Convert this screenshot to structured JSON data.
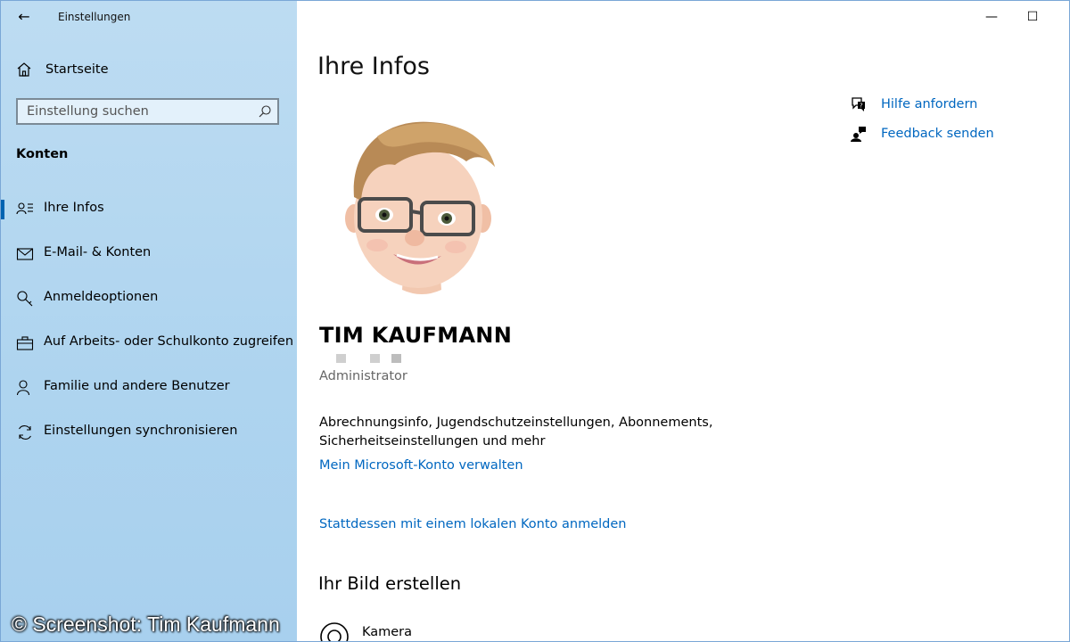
{
  "window": {
    "title": "Einstellungen"
  },
  "sidebar": {
    "home_label": "Startseite",
    "search_placeholder": "Einstellung suchen",
    "section_title": "Konten",
    "items": [
      {
        "label": "Ihre Infos",
        "icon": "person-list-icon",
        "selected": true
      },
      {
        "label": "E-Mail- & Konten",
        "icon": "mail-icon",
        "selected": false
      },
      {
        "label": "Anmeldeoptionen",
        "icon": "key-icon",
        "selected": false
      },
      {
        "label": "Auf Arbeits- oder Schulkonto zugreifen",
        "icon": "briefcase-icon",
        "selected": false
      },
      {
        "label": "Familie und andere Benutzer",
        "icon": "person-add-icon",
        "selected": false
      },
      {
        "label": "Einstellungen synchronisieren",
        "icon": "sync-icon",
        "selected": false
      }
    ]
  },
  "main": {
    "title": "Ihre Infos",
    "user_name": "TIM KAUFMANN",
    "role": "Administrator",
    "description": "Abrechnungsinfo, Jugendschutzeinstellungen, Abonnements, Sicherheitseinstellungen und mehr",
    "manage_link": "Mein Microsoft-Konto verwalten",
    "local_account_link": "Stattdessen mit einem lokalen Konto anmelden",
    "create_picture_heading": "Ihr Bild erstellen",
    "camera_label": "Kamera"
  },
  "help": {
    "get_help": "Hilfe anfordern",
    "feedback": "Feedback senden"
  },
  "watermark": "© Screenshot: Tim Kaufmann",
  "colors": {
    "accent": "#0067c0",
    "sidebar_bg": "#aed4ef",
    "selection_bar": "#0063b1"
  }
}
